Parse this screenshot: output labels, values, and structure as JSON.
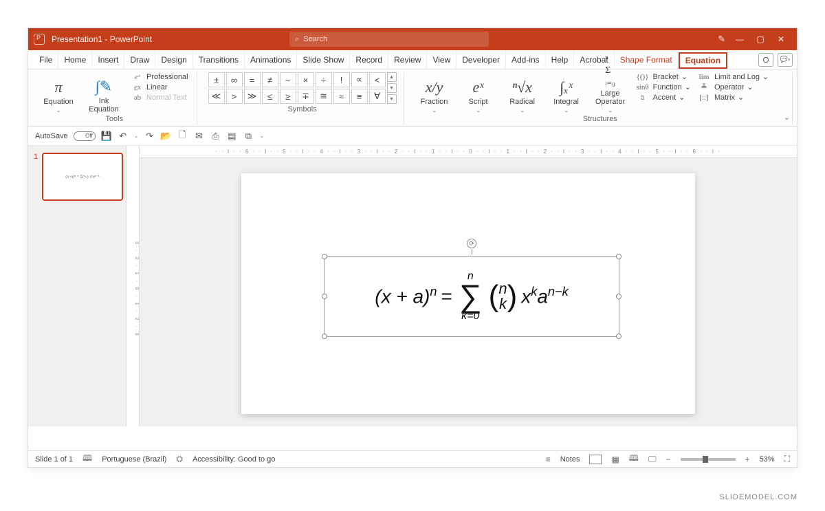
{
  "titlebar": {
    "doc_title": "Presentation1 - PowerPoint",
    "search_placeholder": "Search"
  },
  "tabs": {
    "items": [
      "File",
      "Home",
      "Insert",
      "Draw",
      "Design",
      "Transitions",
      "Animations",
      "Slide Show",
      "Record",
      "Review",
      "View",
      "Developer",
      "Add-ins",
      "Help",
      "Acrobat"
    ],
    "context1": "Shape Format",
    "context2": "Equation"
  },
  "ribbon": {
    "tools": {
      "equation": "Equation",
      "ink_equation": "Ink Equation",
      "professional": "Professional",
      "linear": "Linear",
      "normal_text": "Normal Text",
      "group_label": "Tools"
    },
    "symbols": {
      "row1": [
        "±",
        "∞",
        "=",
        "≠",
        "~",
        "×",
        "÷",
        "!",
        "∝",
        "<"
      ],
      "row2": [
        "≪",
        ">",
        "≫",
        "≤",
        "≥",
        "∓",
        "≅",
        "≈",
        "≡",
        "∀"
      ],
      "group_label": "Symbols"
    },
    "structures": {
      "fraction": "Fraction",
      "script": "Script",
      "radical": "Radical",
      "integral": "Integral",
      "large_op": "Large Operator",
      "bracket": "Bracket",
      "function": "Function",
      "accent": "Accent",
      "limit": "Limit and Log",
      "operator": "Operator",
      "matrix": "Matrix",
      "group_label": "Structures"
    }
  },
  "qat": {
    "autosave_label": "AutoSave",
    "autosave_state": "Off"
  },
  "ruler": {
    "h": "· · l · · 6 · · l · · 5 · · l · · 4 · · l · · 3 · · l · · 2 · · l · · 1 · · l · · 0 · · l · · 1 · · l · · 2 · · l · · 3 · · l · · 4 · · l · · 5 · · l · · 6 · · l ·",
    "v": "3 · 2 · 1 · 0 · 1 · 2 · 3"
  },
  "slide": {
    "thumb_num": "1",
    "thumb_preview": "(x+a)ⁿ = Σ(ⁿₖ) xᵏaⁿ⁻ᵏ",
    "equation_plain": "(x + a)^n = Σ_{k=0}^{n} C(n,k) x^k a^{n-k}"
  },
  "status": {
    "slide_pos": "Slide 1 of 1",
    "language": "Portuguese (Brazil)",
    "accessibility": "Accessibility: Good to go",
    "notes": "Notes",
    "zoom": "53%"
  },
  "watermark": "SLIDEMODEL.COM",
  "colors": {
    "brand": "#c43e1c"
  }
}
